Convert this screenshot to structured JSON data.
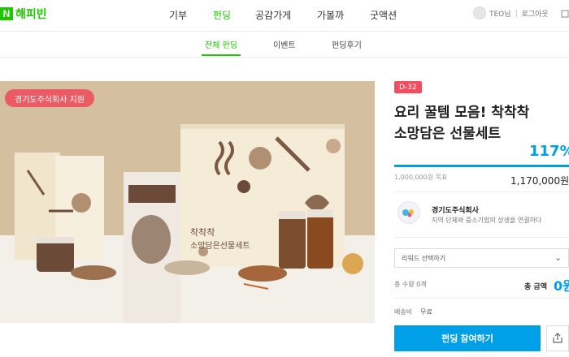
{
  "brand": {
    "badge": "N",
    "name": "해피빈"
  },
  "nav": {
    "items": [
      {
        "label": "기부"
      },
      {
        "label": "펀딩"
      },
      {
        "label": "공감가게"
      },
      {
        "label": "가볼까"
      },
      {
        "label": "굿액션"
      }
    ],
    "active_index": 1
  },
  "user": {
    "name": "TEO님",
    "logout": "로그아웃"
  },
  "subnav": {
    "items": [
      {
        "label": "전체 펀딩"
      },
      {
        "label": "이벤트"
      },
      {
        "label": "펀딩후기"
      }
    ],
    "active_index": 0
  },
  "hero": {
    "support_badge": "경기도주식회사 지원",
    "product_text": {
      "line1": "착착착",
      "line2": "소망담은선물세트"
    }
  },
  "project": {
    "dday": "D-32",
    "title_line1": "요리 꿀템 모음! 착착착",
    "title_line2": "소망담은 선물세트",
    "percent": "117%",
    "progress": 1.17,
    "goal": "1,000,000원 목표",
    "raised": "1,170,000원"
  },
  "organization": {
    "name": "경기도주식회사",
    "description": "지역 단체와 중소기업의 상생을 연결하다"
  },
  "reward": {
    "select_placeholder": "리워드 선택하기",
    "quantity": "총 수량  0개",
    "amount_label": "총 금액",
    "amount_value": "0원"
  },
  "shipping": {
    "label": "배송비",
    "value": "무료"
  },
  "actions": {
    "cta": "펀딩 참여하기"
  },
  "colors": {
    "brand_green": "#1ec800",
    "accent_blue": "#00a0e9",
    "dday_red": "#f24d5f",
    "badge_pink": "#ec5a63"
  },
  "icons": {
    "share": "share-icon",
    "select_arrow": "chevron-down-icon",
    "cart": "cart-icon"
  }
}
